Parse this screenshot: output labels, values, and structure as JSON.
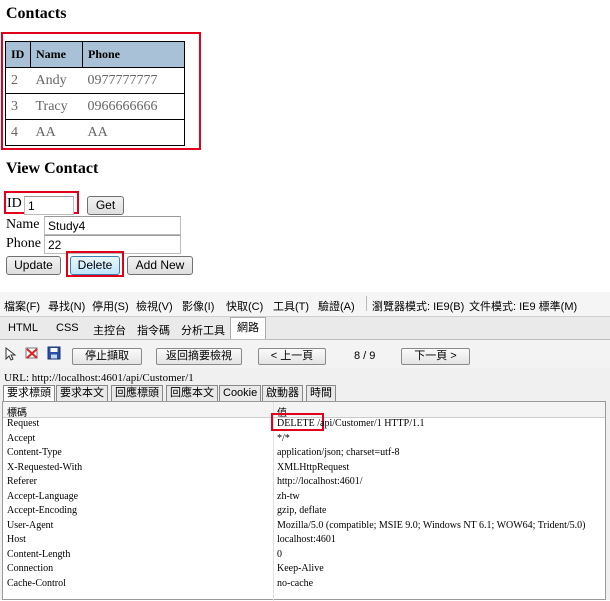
{
  "page": {
    "contacts_heading": "Contacts",
    "view_heading": "View Contact"
  },
  "contacts_table": {
    "headers": [
      "ID",
      "Name",
      "Phone"
    ],
    "rows": [
      [
        "2",
        "Andy",
        "0977777777"
      ],
      [
        "3",
        "Tracy",
        "0966666666"
      ],
      [
        "4",
        "AA",
        "AA"
      ]
    ]
  },
  "view_form": {
    "id_label": "ID",
    "id_value": "1",
    "get_button": "Get",
    "name_label": "Name",
    "name_value": "Study4",
    "phone_label": "Phone",
    "phone_value": "22",
    "update_button": "Update",
    "delete_button": "Delete",
    "add_button": "Add New"
  },
  "devtools": {
    "menu": [
      "檔案(F)",
      "尋找(N)",
      "停用(S)",
      "檢視(V)",
      "影像(I)",
      "快取(C)",
      "工具(T)",
      "驗證(A)",
      "瀏覽器模式: IE9(B)",
      "文件模式: IE9 標準(M)"
    ],
    "tabs": [
      "HTML",
      "CSS",
      "主控台",
      "指令碼",
      "分析工具",
      "網路"
    ],
    "active_tab": "網路",
    "toolbar": {
      "stop_capture": "停止擷取",
      "back_to_summary": "返回摘要檢視",
      "prev": "< 上一頁",
      "page_indicator": "8 / 9",
      "next": "下一頁 >"
    },
    "url": "URL: http://localhost:4601/api/Customer/1",
    "subtabs": [
      "要求標頭",
      "要求本文",
      "回應標頭",
      "回應本文",
      "Cookie",
      "啟動器",
      "時間"
    ],
    "active_subtab": "要求標頭",
    "grid_headers": {
      "key": "標碼",
      "value": "值"
    },
    "headers": [
      {
        "key": "Request",
        "value": "DELETE /api/Customer/1 HTTP/1.1"
      },
      {
        "key": "Accept",
        "value": "*/*"
      },
      {
        "key": "Content-Type",
        "value": "application/json; charset=utf-8"
      },
      {
        "key": "X-Requested-With",
        "value": "XMLHttpRequest"
      },
      {
        "key": "Referer",
        "value": "http://localhost:4601/"
      },
      {
        "key": "Accept-Language",
        "value": "zh-tw"
      },
      {
        "key": "Accept-Encoding",
        "value": "gzip, deflate"
      },
      {
        "key": "User-Agent",
        "value": "Mozilla/5.0 (compatible; MSIE 9.0; Windows NT 6.1; WOW64; Trident/5.0)"
      },
      {
        "key": "Host",
        "value": "localhost:4601"
      },
      {
        "key": "Content-Length",
        "value": "0"
      },
      {
        "key": "Connection",
        "value": "Keep-Alive"
      },
      {
        "key": "Cache-Control",
        "value": "no-cache"
      }
    ]
  },
  "colors": {
    "highlight": "#e0001b",
    "table_header": "#a9c1d6"
  }
}
